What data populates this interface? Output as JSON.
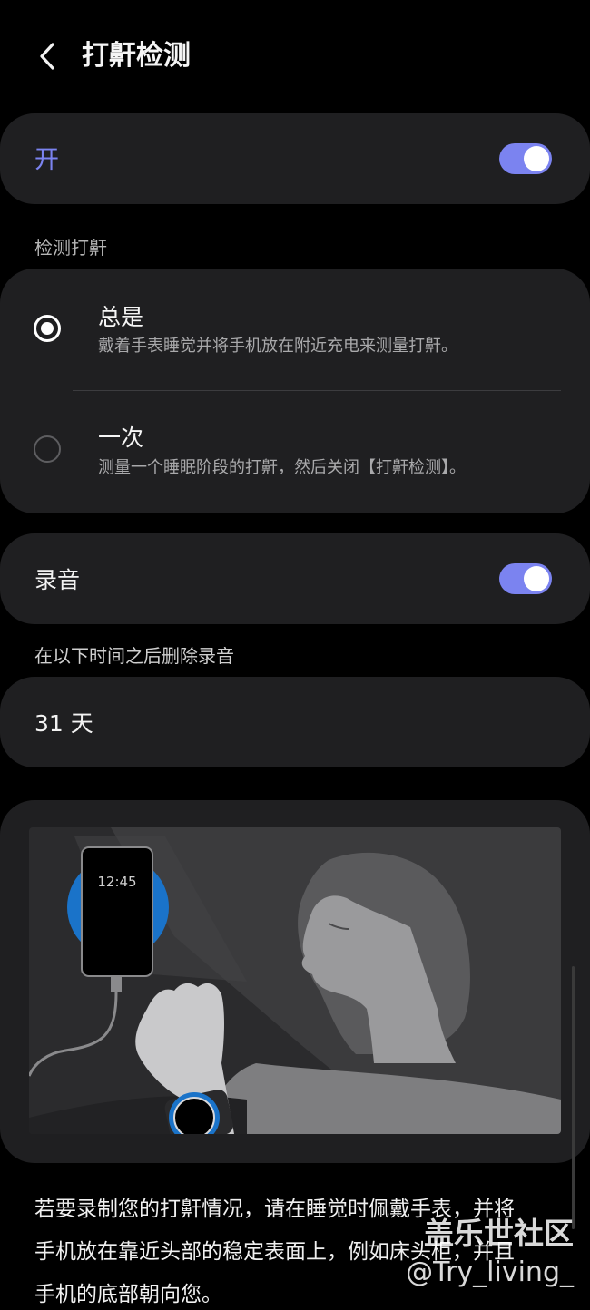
{
  "header": {
    "title": "打鼾检测",
    "back_icon": "chevron-left-icon"
  },
  "master": {
    "label": "开",
    "switch_on": true
  },
  "detect_section": {
    "label": "检测打鼾",
    "options": [
      {
        "title": "总是",
        "desc": "戴着手表睡觉并将手机放在附近充电来测量打鼾。",
        "selected": true
      },
      {
        "title": "一次",
        "desc": "测量一个睡眠阶段的打鼾，然后关闭【打鼾检测】。",
        "selected": false
      }
    ]
  },
  "recording": {
    "label": "录音",
    "switch_on": true
  },
  "delete_section": {
    "label": "在以下时间之后删除录音",
    "value": "31 天"
  },
  "illustration": {
    "phone_time": "12:45"
  },
  "info": {
    "line1": "若要录制您的打鼾情况，请在睡觉时佩戴手表，并将",
    "line2": "手机放在靠近头部的稳定表面上，例如床头柜，并且",
    "line3": "手机的底部朝向您。"
  },
  "watermark": {
    "line1": "盖乐世社区",
    "line2": "@Try_living_"
  },
  "colors": {
    "accent": "#7b83f0",
    "card": "#1f1f21",
    "background": "#000000",
    "charger": "#1a73c9"
  }
}
